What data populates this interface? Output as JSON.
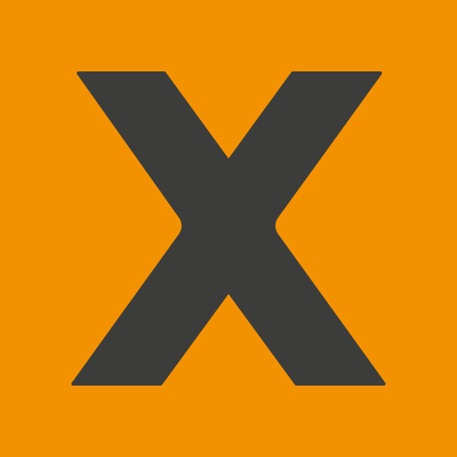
{
  "icon": {
    "name": "x-logo-icon",
    "glyph": "X",
    "background_color": "#F39200",
    "glyph_color": "#3C3C3B"
  }
}
